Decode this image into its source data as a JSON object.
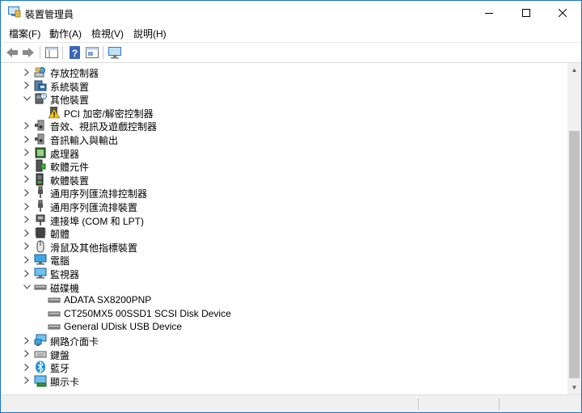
{
  "window": {
    "title": "裝置管理員"
  },
  "menu": [
    "檔案(F)",
    "動作(A)",
    "檢視(V)",
    "說明(H)"
  ],
  "colors": {
    "window_border": "#1a73c9",
    "icon_blue": "#1e8fd6"
  },
  "tree": [
    {
      "label": "存放控制器",
      "level": 1,
      "state": "collapsed",
      "icon": "storage-controller-icon"
    },
    {
      "label": "系統裝置",
      "level": 1,
      "state": "collapsed",
      "icon": "system-device-icon"
    },
    {
      "label": "其他裝置",
      "level": 1,
      "state": "expanded",
      "icon": "other-device-icon"
    },
    {
      "label": "PCI 加密/解密控制器",
      "level": 2,
      "state": "leaf",
      "icon": "warning-icon"
    },
    {
      "label": "音效、視訊及遊戲控制器",
      "level": 1,
      "state": "collapsed",
      "icon": "speaker-icon"
    },
    {
      "label": "音訊輸入與輸出",
      "level": 1,
      "state": "collapsed",
      "icon": "speaker-icon"
    },
    {
      "label": "處理器",
      "level": 1,
      "state": "collapsed",
      "icon": "processor-icon"
    },
    {
      "label": "軟體元件",
      "level": 1,
      "state": "collapsed",
      "icon": "software-component-icon"
    },
    {
      "label": "軟體裝置",
      "level": 1,
      "state": "collapsed",
      "icon": "software-device-icon"
    },
    {
      "label": "通用序列匯流排控制器",
      "level": 1,
      "state": "collapsed",
      "icon": "usb-icon"
    },
    {
      "label": "通用序列匯流排裝置",
      "level": 1,
      "state": "collapsed",
      "icon": "usb-icon"
    },
    {
      "label": "連接埠 (COM 和 LPT)",
      "level": 1,
      "state": "collapsed",
      "icon": "port-icon"
    },
    {
      "label": "韌體",
      "level": 1,
      "state": "collapsed",
      "icon": "firmware-icon"
    },
    {
      "label": "滑鼠及其他指標裝置",
      "level": 1,
      "state": "collapsed",
      "icon": "mouse-icon"
    },
    {
      "label": "電腦",
      "level": 1,
      "state": "collapsed",
      "icon": "computer-icon"
    },
    {
      "label": "監視器",
      "level": 1,
      "state": "collapsed",
      "icon": "monitor-icon"
    },
    {
      "label": "磁碟機",
      "level": 1,
      "state": "expanded",
      "icon": "disk-drive-icon"
    },
    {
      "label": "ADATA SX8200PNP",
      "level": 2,
      "state": "leaf",
      "icon": "disk-drive-icon"
    },
    {
      "label": "CT250MX5 00SSD1 SCSI Disk Device",
      "level": 2,
      "state": "leaf",
      "icon": "disk-drive-icon"
    },
    {
      "label": "General UDisk USB Device",
      "level": 2,
      "state": "leaf",
      "icon": "disk-drive-icon"
    },
    {
      "label": "網路介面卡",
      "level": 1,
      "state": "collapsed",
      "icon": "network-adapter-icon"
    },
    {
      "label": "鍵盤",
      "level": 1,
      "state": "collapsed",
      "icon": "keyboard-icon"
    },
    {
      "label": "藍牙",
      "level": 1,
      "state": "collapsed",
      "icon": "bluetooth-icon"
    },
    {
      "label": "顯示卡",
      "level": 1,
      "state": "collapsed",
      "icon": "display-adapter-icon"
    }
  ]
}
